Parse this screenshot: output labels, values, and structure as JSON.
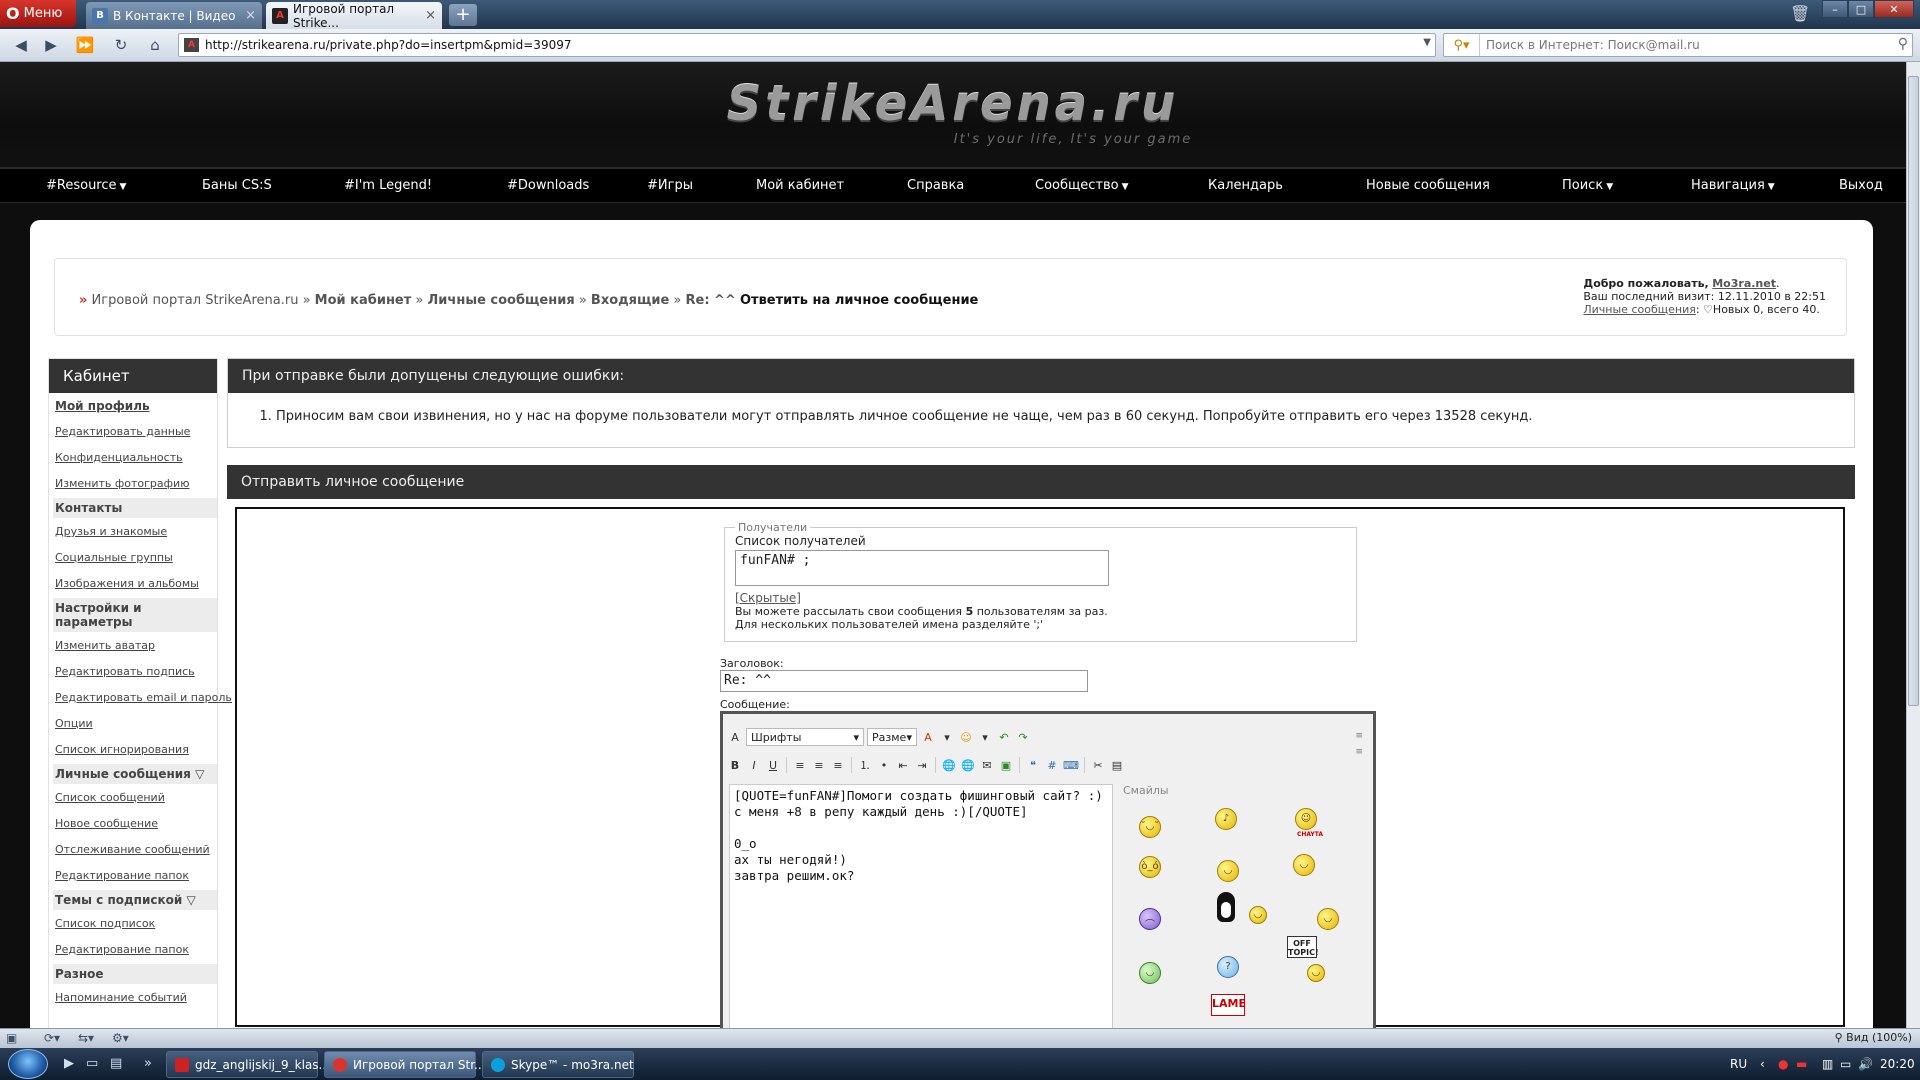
{
  "browser": {
    "menu_label": "Меню",
    "tabs": [
      {
        "label": "В Контакте | Видео",
        "favicon": "В",
        "active": false
      },
      {
        "label": "Игровой портал Strike...",
        "favicon": "A",
        "active": true
      }
    ],
    "newtab_label": "+",
    "url": "http://strikearena.ru/private.php?do=insertpm&pmid=39097",
    "search_placeholder": "Поиск в Интернет: Поиск@mail.ru",
    "zoom_label": "Вид (100%)"
  },
  "site": {
    "logo": "StrikeArena.ru",
    "tagline": "It's your life, It's your game",
    "menu": [
      {
        "label": "#Resource",
        "dropdown": true
      },
      {
        "label": "Баны CS:S",
        "dropdown": false
      },
      {
        "label": "#I'm Legend!",
        "dropdown": false
      },
      {
        "label": "#Downloads",
        "dropdown": false
      },
      {
        "label": "#Игры",
        "dropdown": false
      },
      {
        "label": "Мой кабинет",
        "dropdown": false
      },
      {
        "label": "Справка",
        "dropdown": false
      },
      {
        "label": "Сообщество",
        "dropdown": true
      },
      {
        "label": "Календарь",
        "dropdown": false
      },
      {
        "label": "Новые сообщения",
        "dropdown": false
      },
      {
        "label": "Поиск",
        "dropdown": true
      },
      {
        "label": "Навигация",
        "dropdown": true
      },
      {
        "label": "Выход",
        "dropdown": false
      }
    ],
    "breadcrumb": {
      "home": "Игровой портал StrikeArena.ru",
      "items": [
        "Мой кабинет",
        "Личные сообщения",
        "Входящие",
        "Re: ^^"
      ],
      "current": "Ответить на личное сообщение"
    },
    "welcome": {
      "greeting": "Добро пожаловать,",
      "username": "Mo3ra.net",
      "last_visit": "Ваш последний визит: 12.11.2010 в 22:51",
      "pm_link": "Личные сообщения",
      "pm_counts": "Новых 0, всего 40."
    }
  },
  "sidebar": {
    "title": "Кабинет",
    "items": [
      {
        "label": "Мой профиль",
        "type": "bold-link"
      },
      {
        "label": "Редактировать данные",
        "type": "link"
      },
      {
        "label": "Конфиденциальность",
        "type": "link"
      },
      {
        "label": "Изменить фотографию",
        "type": "link"
      },
      {
        "label": "Контакты",
        "type": "section"
      },
      {
        "label": "Друзья и знакомые",
        "type": "link"
      },
      {
        "label": "Социальные группы",
        "type": "link"
      },
      {
        "label": "Изображения и альбомы",
        "type": "link"
      },
      {
        "label": "Настройки и параметры",
        "type": "section"
      },
      {
        "label": "Изменить аватар",
        "type": "link"
      },
      {
        "label": "Редактировать подпись",
        "type": "link"
      },
      {
        "label": "Редактировать email и пароль",
        "type": "link"
      },
      {
        "label": "Опции",
        "type": "link"
      },
      {
        "label": "Список игнорирования",
        "type": "link"
      },
      {
        "label": "Личные сообщения",
        "type": "section",
        "collapse": true
      },
      {
        "label": "Список сообщений",
        "type": "link"
      },
      {
        "label": "Новое сообщение",
        "type": "link"
      },
      {
        "label": "Отслеживание сообщений",
        "type": "link"
      },
      {
        "label": "Редактирование папок",
        "type": "link"
      },
      {
        "label": "Темы с подпиской",
        "type": "section",
        "collapse": true
      },
      {
        "label": "Список подписок",
        "type": "link"
      },
      {
        "label": "Редактирование папок",
        "type": "link"
      },
      {
        "label": "Разное",
        "type": "section"
      },
      {
        "label": "Напоминание событий",
        "type": "link"
      }
    ]
  },
  "errors": {
    "title": "При отправке были допущены следующие ошибки:",
    "items": [
      "Приносим вам свои извинения, но у нас на форуме пользователи могут отправлять личное сообщение не чаще, чем раз в 60 секунд. Попробуйте отправить его через 13528 секунд."
    ]
  },
  "compose": {
    "title": "Отправить личное сообщение",
    "recipients_legend": "Получатели",
    "recipients_label": "Список получателей",
    "recipients_value": "funFAN# ;",
    "hidden_link": "[Скрытые]",
    "note_1_pre": "Вы можете рассылать свои сообщения",
    "note_1_count": "5",
    "note_1_post": "пользователям за раз.",
    "note_2": "Для нескольких пользователей имена разделяйте ';'",
    "subject_label": "Заголовок:",
    "subject_value": "Re: ^^",
    "message_label": "Сообщение:",
    "font_select": "Шрифты",
    "size_select": "Разме",
    "message_text": "[QUOTE=funFAN#]Помоги создать фишинговый сайт? :)\nс меня +8 в репу каждый день :)[/QUOTE]\n\n0_o\nах ты негодяй!)\nзавтра решим.ок?",
    "smilies_title": "Смайлы",
    "sign_offtopic": "OFF TOPIC!",
    "sign_lame": "LAME",
    "sign_chayta": "CHAYTA",
    "toolbar_icons": [
      "bold-icon",
      "italic-icon",
      "underline-icon",
      "align-left-icon",
      "align-center-icon",
      "align-right-icon",
      "ordered-list-icon",
      "unordered-list-icon",
      "outdent-icon",
      "indent-icon",
      "link-icon",
      "unlink-icon",
      "email-icon",
      "image-icon",
      "quote-icon",
      "code-icon",
      "php-icon",
      "cut-icon",
      "preview-icon"
    ]
  },
  "taskbar": {
    "buttons": [
      {
        "label": "gdz_anglijskij_9_klas...",
        "active": false
      },
      {
        "label": "Игровой портал Str...",
        "active": true
      },
      {
        "label": "Skype™ - mo3ra.net",
        "active": false
      }
    ],
    "lang": "RU",
    "clock": "20:20"
  },
  "colors": {
    "site_bg": "#0e0e0e",
    "panel_head": "#333333",
    "opera_red": "#d8352c",
    "breadcrumb_arrow": "#cc3333"
  }
}
